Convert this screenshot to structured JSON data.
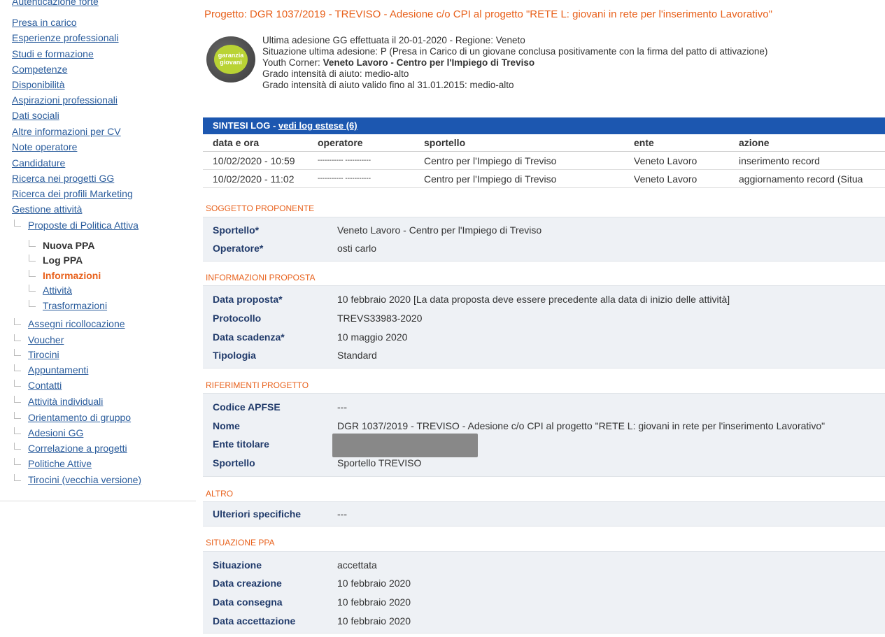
{
  "sidebar": {
    "cut_item": "Autenticazione forte",
    "items": [
      {
        "label": "Presa in carico"
      },
      {
        "label": "Esperienze professionali"
      },
      {
        "label": "Studi e formazione"
      },
      {
        "label": "Competenze"
      },
      {
        "label": "Disponibilità"
      },
      {
        "label": "Aspirazioni professionali"
      },
      {
        "label": "Dati sociali"
      },
      {
        "label": "Altre informazioni per CV"
      },
      {
        "label": "Note operatore"
      },
      {
        "label": "Candidature"
      },
      {
        "label": "Ricerca nei progetti GG"
      },
      {
        "label": "Ricerca dei profili Marketing"
      },
      {
        "label": "Gestione attività"
      }
    ],
    "sub_items": [
      {
        "label": "Proposte di Politica Attiva"
      },
      {
        "label": "Nuova PPA"
      },
      {
        "label": "Log PPA"
      },
      {
        "label": "Informazioni"
      },
      {
        "label": "Attività"
      },
      {
        "label": "Trasformazioni"
      },
      {
        "label": "Assegni ricollocazione"
      },
      {
        "label": "Voucher"
      },
      {
        "label": "Tirocini"
      },
      {
        "label": "Appuntamenti"
      },
      {
        "label": "Contatti"
      },
      {
        "label": "Attività individuali"
      },
      {
        "label": "Orientamento di gruppo"
      },
      {
        "label": "Adesioni GG"
      },
      {
        "label": "Correlazione a progetti"
      },
      {
        "label": "Politiche Attive"
      },
      {
        "label": "Tirocini (vecchia versione)"
      }
    ]
  },
  "header": {
    "title": "Progetto: DGR 1037/2019 - TREVISO - Adesione c/o CPI al progetto \"RETE L: giovani in rete per l'inserimento Lavorativo\"",
    "logo_text": "garanzia giovani"
  },
  "gg": {
    "line1": "Ultima adesione GG effettuata il 20-01-2020 - Regione: Veneto",
    "line2": "Situazione ultima adesione: P (Presa in Carico di un giovane conclusa positivamente con la firma del patto di attivazione)",
    "line3_label": "Youth Corner: ",
    "line3_value": "Veneto Lavoro - Centro per l'Impiego di Treviso",
    "line4": "Grado intensità di aiuto: medio-alto",
    "line5": "Grado intensità di aiuto valido fino al 31.01.2015: medio-alto"
  },
  "log": {
    "title": "SINTESI LOG - ",
    "link": "vedi log estese (6)",
    "columns": [
      "data e ora",
      "operatore",
      "sportello",
      "ente",
      "azione"
    ],
    "rows": [
      [
        "10/02/2020 - 10:59",
        "----------- -----------",
        "Centro per l'Impiego di Treviso",
        "Veneto Lavoro",
        "inserimento record"
      ],
      [
        "10/02/2020 - 11:02",
        "----------- -----------",
        "Centro per l'Impiego di Treviso",
        "Veneto Lavoro",
        "aggiornamento record (Situa"
      ]
    ]
  },
  "soggetto": {
    "title": "SOGGETTO PROPONENTE",
    "sportello_label": "Sportello*",
    "sportello_value": "Veneto Lavoro - Centro per l'Impiego di Treviso",
    "operatore_label": "Operatore*",
    "operatore_value": "osti carlo"
  },
  "info": {
    "title": "INFORMAZIONI PROPOSTA",
    "data_label": "Data proposta*",
    "data_value": "10 febbraio 2020 [La data proposta deve essere precedente alla data di inizio delle attività]",
    "protocollo_label": "Protocollo",
    "protocollo_value": "TREVS33983-2020",
    "scadenza_label": "Data scadenza*",
    "scadenza_value": "10 maggio 2020",
    "tipologia_label": "Tipologia",
    "tipologia_value": "Standard"
  },
  "riferimenti": {
    "title": "RIFERIMENTI PROGETTO",
    "codice_label": "Codice APFSE",
    "codice_value": "---",
    "nome_label": "Nome",
    "nome_value": "DGR 1037/2019 - TREVISO - Adesione c/o CPI al progetto \"RETE L: giovani in rete per l'inserimento Lavorativo\"",
    "ente_label": "Ente titolare",
    "sportello_label": "Sportello",
    "sportello_value": "Sportello TREVISO"
  },
  "altro": {
    "title": "ALTRO",
    "label": "Ulteriori specifiche",
    "value": "---"
  },
  "situazione": {
    "title": "SITUAZIONE PPA",
    "s_label": "Situazione",
    "s_value": "accettata",
    "creazione_label": "Data creazione",
    "creazione_value": "10 febbraio 2020",
    "consegna_label": "Data consegna",
    "consegna_value": "10 febbraio 2020",
    "accettazione_label": "Data accettazione",
    "accettazione_value": "10 febbraio 2020"
  }
}
